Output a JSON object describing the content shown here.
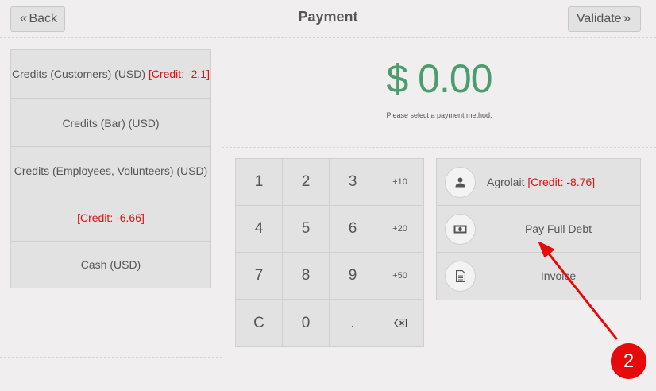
{
  "header": {
    "back_label": "Back",
    "title": "Payment",
    "validate_label": "Validate"
  },
  "payment_methods": [
    {
      "label": "Credits (Customers) (USD)",
      "credit": "[Credit: -2.1]"
    },
    {
      "label": "Credits (Bar) (USD)",
      "credit": ""
    },
    {
      "label": "Credits (Employees, Volunteers) (USD)",
      "credit": "[Credit: -6.66]"
    },
    {
      "label": "Cash (USD)",
      "credit": ""
    }
  ],
  "summary": {
    "amount": "$ 0.00",
    "message": "Please select a payment method."
  },
  "numpad": {
    "keys": [
      "1",
      "2",
      "3",
      "+10",
      "4",
      "5",
      "6",
      "+20",
      "7",
      "8",
      "9",
      "+50",
      "C",
      "0",
      ".",
      ""
    ]
  },
  "actions": {
    "customer": {
      "name": "Agrolait",
      "credit": "[Credit: -8.76]",
      "icon": "user-icon"
    },
    "pay_debt": {
      "label": "Pay Full Debt",
      "icon": "money-icon"
    },
    "invoice": {
      "label": "Invoice",
      "icon": "document-icon"
    }
  },
  "annotation": {
    "number": "2",
    "color": "#e80a0a"
  },
  "colors": {
    "amount": "#4a9e6e",
    "credit": "#e01212",
    "background": "#f0eeee",
    "button": "#e2e2e2"
  }
}
